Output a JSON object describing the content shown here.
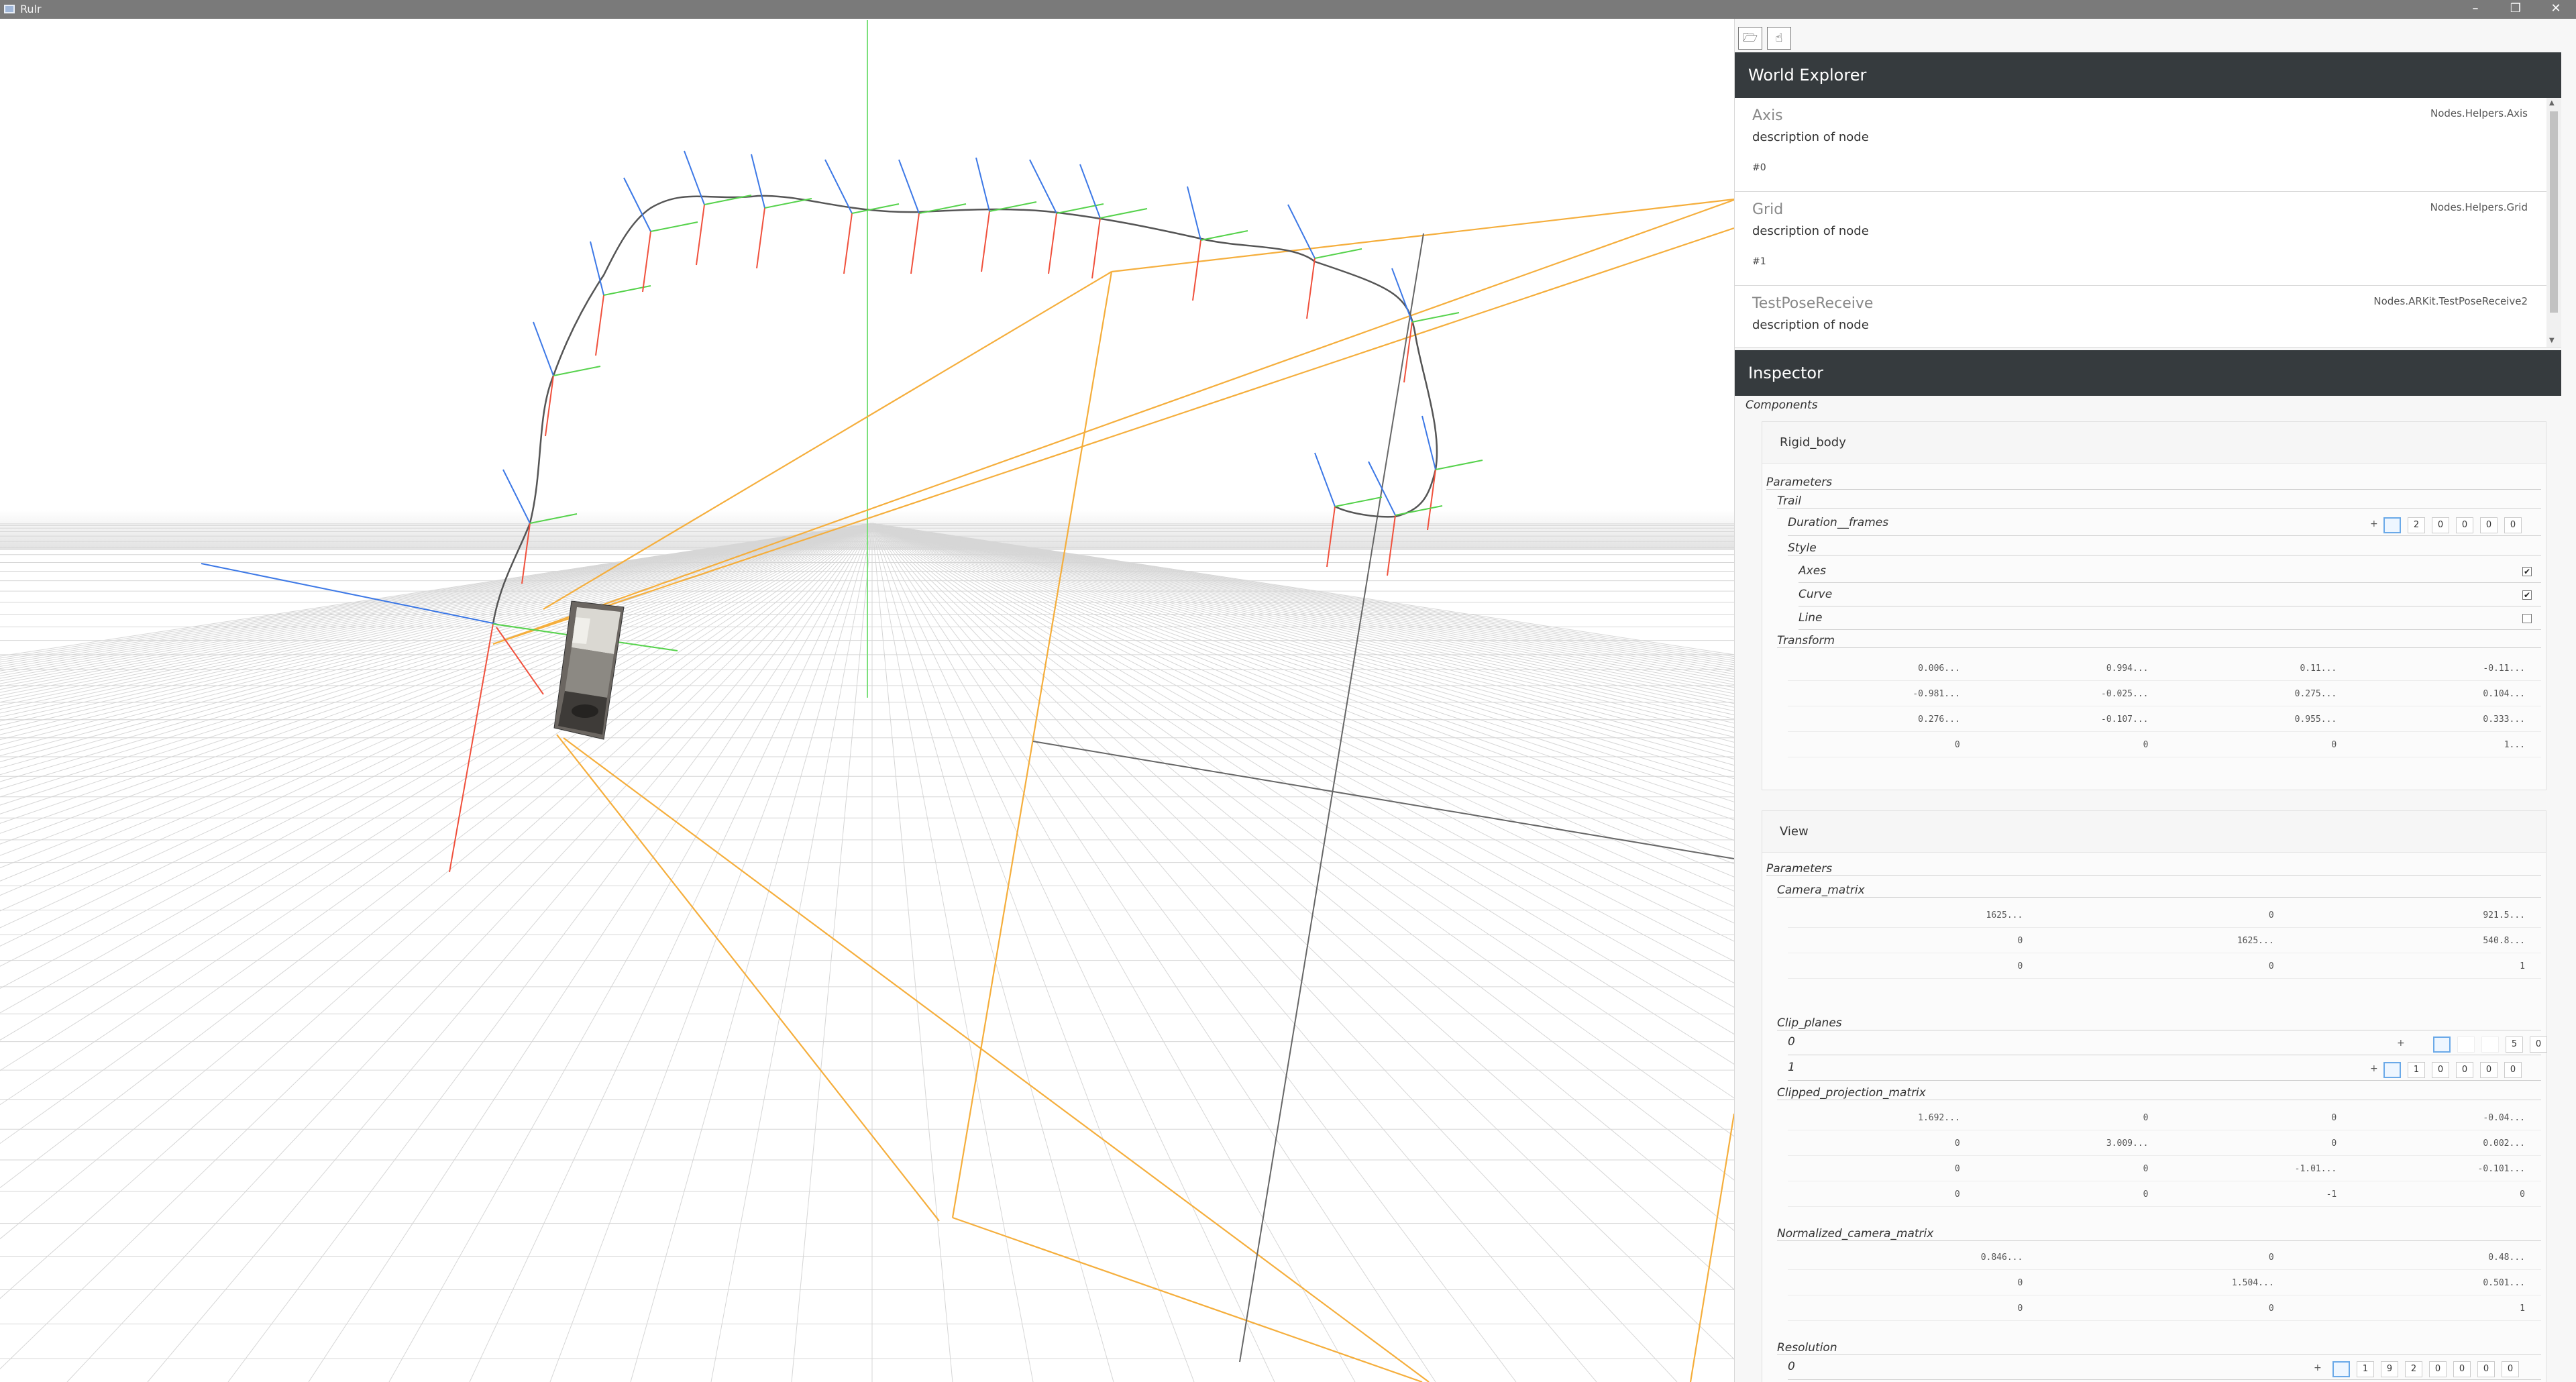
{
  "window": {
    "title": "Rulr",
    "minimize": "–",
    "maximize": "❐",
    "close": "✕"
  },
  "toolbar": {
    "open_icon": "folder-open-icon",
    "open_glyph": "🗁",
    "hand_icon": "hand-icon",
    "hand_glyph": "☝"
  },
  "world_explorer": {
    "title": "World Explorer",
    "nodes": [
      {
        "name": "Axis",
        "description": "description of node",
        "id": "#0",
        "type": "Nodes.Helpers.Axis"
      },
      {
        "name": "Grid",
        "description": "description of node",
        "id": "#1",
        "type": "Nodes.Helpers.Grid"
      },
      {
        "name": "TestPoseReceive",
        "description": "description of node",
        "id": "",
        "type": "Nodes.ARKit.TestPoseReceive2"
      }
    ]
  },
  "inspector": {
    "title": "Inspector",
    "components_label": "Components",
    "rigid_body": {
      "title": "Rigid_body",
      "parameters_label": "Parameters",
      "trail_label": "Trail",
      "duration_label": "Duration__frames",
      "duration_digits": [
        "",
        "2",
        "0",
        "0",
        "0",
        "0"
      ],
      "style_label": "Style",
      "style_options": [
        {
          "label": "Axes",
          "checked": true,
          "mark": "✔"
        },
        {
          "label": "Curve",
          "checked": true,
          "mark": "✔"
        },
        {
          "label": "Line",
          "checked": false,
          "mark": ""
        }
      ],
      "transform_label": "Transform",
      "transform": [
        [
          "0.006...",
          "0.994...",
          "0.11...",
          "-0.11..."
        ],
        [
          "-0.981...",
          "-0.025...",
          "0.275...",
          "0.104..."
        ],
        [
          "0.276...",
          "-0.107...",
          "0.955...",
          "0.333..."
        ],
        [
          "0",
          "0",
          "0",
          "1..."
        ]
      ]
    },
    "view": {
      "title": "View",
      "parameters_label": "Parameters",
      "camera_matrix_label": "Camera_matrix",
      "camera_matrix": [
        [
          "1625...",
          "0",
          "921.5..."
        ],
        [
          "0",
          "1625...",
          "540.8..."
        ],
        [
          "0",
          "0",
          "1"
        ]
      ],
      "clip_planes_label": "Clip_planes",
      "clip_planes": [
        {
          "index": "0",
          "digits": [
            "",
            "",
            "",
            "5",
            "0"
          ]
        },
        {
          "index": "1",
          "digits": [
            "",
            "1",
            "0",
            "0",
            "0",
            "0"
          ]
        }
      ],
      "clipped_projection_label": "Clipped_projection_matrix",
      "clipped_projection": [
        [
          "1.692...",
          "0",
          "0",
          "-0.04..."
        ],
        [
          "0",
          "3.009...",
          "0",
          "0.002..."
        ],
        [
          "0",
          "0",
          "-1.01...",
          "-0.101..."
        ],
        [
          "0",
          "0",
          "-1",
          "0"
        ]
      ],
      "normalized_camera_label": "Normalized_camera_matrix",
      "normalized_camera": [
        [
          "0.846...",
          "0",
          "0.48..."
        ],
        [
          "0",
          "1.504...",
          "0.501..."
        ],
        [
          "0",
          "0",
          "1"
        ]
      ],
      "resolution_label": "Resolution",
      "resolution": {
        "index": "0",
        "digits": [
          "",
          "1",
          "9",
          "2",
          "0",
          "0",
          "0",
          "0"
        ]
      }
    }
  },
  "colors": {
    "panel_header": "#363b3e",
    "axis_red": "#f0503c",
    "axis_green": "#55d24b",
    "axis_blue": "#3c78e6",
    "frustum": "#f5ae3c"
  }
}
